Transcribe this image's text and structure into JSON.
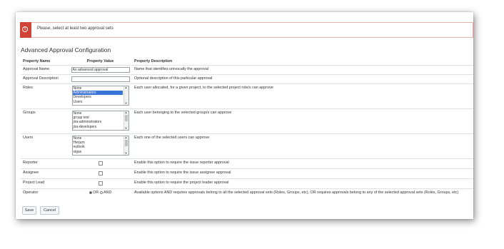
{
  "alert": {
    "message": "Please, select at least two approval sets",
    "icon": "error-icon",
    "color": "#d04437"
  },
  "page_title": "Advanced Approval Configuration",
  "table": {
    "headers": {
      "name": "Property Name",
      "value": "Property Value",
      "description": "Property Description"
    },
    "rows": {
      "approval_name": {
        "name": "Approval Name",
        "value": "An advanced approval",
        "description": "Name that identifies univocally the approval"
      },
      "approval_description": {
        "name": "Approval Description",
        "value": "",
        "description": "Optional description of this particular approval"
      },
      "roles": {
        "name": "Roles",
        "options": [
          "None",
          "Administrators",
          "Developers",
          "Users"
        ],
        "selected": "Administrators",
        "description": "Each user allocated, for a given project, to the selected project role/s can approve"
      },
      "groups": {
        "name": "Groups",
        "options": [
          "None",
          "group test",
          "jira-administrators",
          "jira-developers"
        ],
        "description": "Each user belonging to the selected group/s can approve"
      },
      "users": {
        "name": "Users",
        "options": [
          "None",
          "Herjum",
          "outlook",
          "sigas"
        ],
        "description": "Each one of the selected users can approve"
      },
      "reporter": {
        "name": "Reporter",
        "description": "Enable this option to require the issue reporter approval"
      },
      "assignee": {
        "name": "Assignee",
        "description": "Enable this option to require the issue assignee approval"
      },
      "project_lead": {
        "name": "Project Lead",
        "description": "Enable this option to require the project leader approval"
      },
      "operator": {
        "name": "Operator",
        "option_or": "OR",
        "option_and": "AND",
        "selected": "OR",
        "description": "Available options AND requires approvals belong to all the selected approval sets (Roles, Groups, etc), OR requires approvals belong to any of the selected approval sets (Roles, Groups, etc)"
      }
    }
  },
  "buttons": {
    "save": "Save",
    "cancel": "Cancel"
  }
}
